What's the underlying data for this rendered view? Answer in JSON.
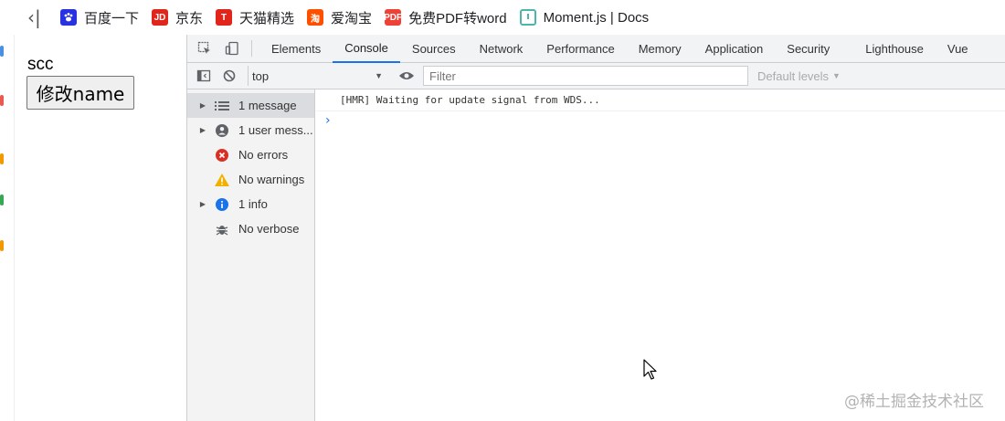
{
  "bookmarks_bar": {
    "items": [
      {
        "label": "百度一下",
        "icon": "baidu-paw-icon"
      },
      {
        "label": "京东",
        "icon": "jd-logo-icon",
        "badge": "JD"
      },
      {
        "label": "天猫精选",
        "icon": "tmall-logo-icon",
        "badge": "T"
      },
      {
        "label": "爱淘宝",
        "icon": "taobao-logo-icon",
        "badge": "淘"
      },
      {
        "label": "免费PDF转word",
        "icon": "pdf-logo-icon",
        "badge": "PDF"
      },
      {
        "label": "Moment.js | Docs",
        "icon": "moment-clock-icon"
      }
    ]
  },
  "page": {
    "text": "scc",
    "button_label": "修改name"
  },
  "devtools": {
    "tabs": [
      {
        "label": "Elements",
        "active": false
      },
      {
        "label": "Console",
        "active": true
      },
      {
        "label": "Sources",
        "active": false
      },
      {
        "label": "Network",
        "active": false
      },
      {
        "label": "Performance",
        "active": false
      },
      {
        "label": "Memory",
        "active": false
      },
      {
        "label": "Application",
        "active": false
      },
      {
        "label": "Security",
        "active": false
      },
      {
        "label": "Lighthouse",
        "active": false
      },
      {
        "label": "Vue",
        "active": false
      }
    ],
    "toolbar": {
      "context": "top",
      "filter_placeholder": "Filter",
      "levels": "Default levels"
    },
    "sidebar": [
      {
        "label": "1 message",
        "icon": "list-icon",
        "expandable": true,
        "selected": true
      },
      {
        "label": "1 user mess...",
        "icon": "user-icon",
        "expandable": true,
        "selected": false
      },
      {
        "label": "No errors",
        "icon": "error-icon",
        "expandable": false,
        "selected": false
      },
      {
        "label": "No warnings",
        "icon": "warning-icon",
        "expandable": false,
        "selected": false
      },
      {
        "label": "1 info",
        "icon": "info-icon",
        "expandable": true,
        "selected": false
      },
      {
        "label": "No verbose",
        "icon": "bug-icon",
        "expandable": false,
        "selected": false
      }
    ],
    "console_output": [
      "[HMR] Waiting for update signal from WDS..."
    ]
  },
  "watermark": "@稀土掘金技术社区",
  "colors": {
    "accent": "#1a73e8",
    "error": "#d93025",
    "warning": "#f2b100",
    "info": "#1a73e8"
  }
}
